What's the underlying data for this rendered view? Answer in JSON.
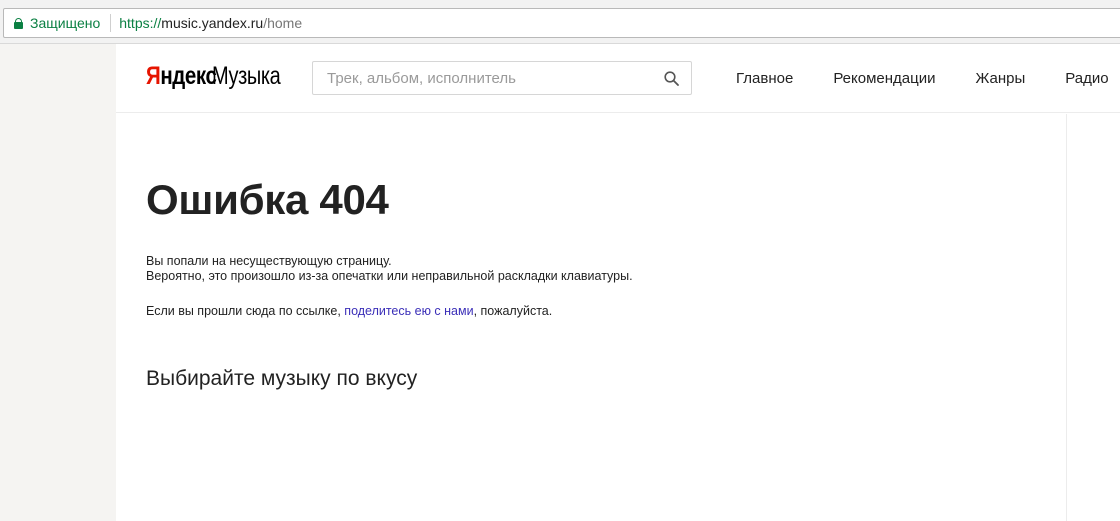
{
  "browser": {
    "secure_label": "Защищено",
    "url_scheme": "https://",
    "url_host": "music.yandex.ru",
    "url_path": "/home",
    "accent_secure": "#0b8043"
  },
  "header": {
    "logo_yandex_first": "Я",
    "logo_yandex_rest": "ндекс",
    "logo_music": "Музыка",
    "search_placeholder": "Трек, альбом, исполнитель",
    "nav": [
      {
        "label": "Главное"
      },
      {
        "label": "Рекомендации"
      },
      {
        "label": "Жанры"
      },
      {
        "label": "Радио"
      }
    ]
  },
  "main": {
    "error_title": "Ошибка 404",
    "line1": "Вы попали на несуществующую страницу.",
    "line2": "Вероятно, это произошло из-за опечатки или неправильной раскладки клавиатуры.",
    "line3_before": "Если вы прошли сюда по ссылке, ",
    "line3_link": "поделитесь ею с нами",
    "line3_after": ", пожалуйста.",
    "section_title": "Выбирайте музыку по вкусу"
  },
  "colors": {
    "brand_red": "#e61400",
    "link": "#3b2fb8",
    "text": "#222222"
  },
  "icons": {
    "lock": "lock-icon",
    "search": "search-icon"
  }
}
